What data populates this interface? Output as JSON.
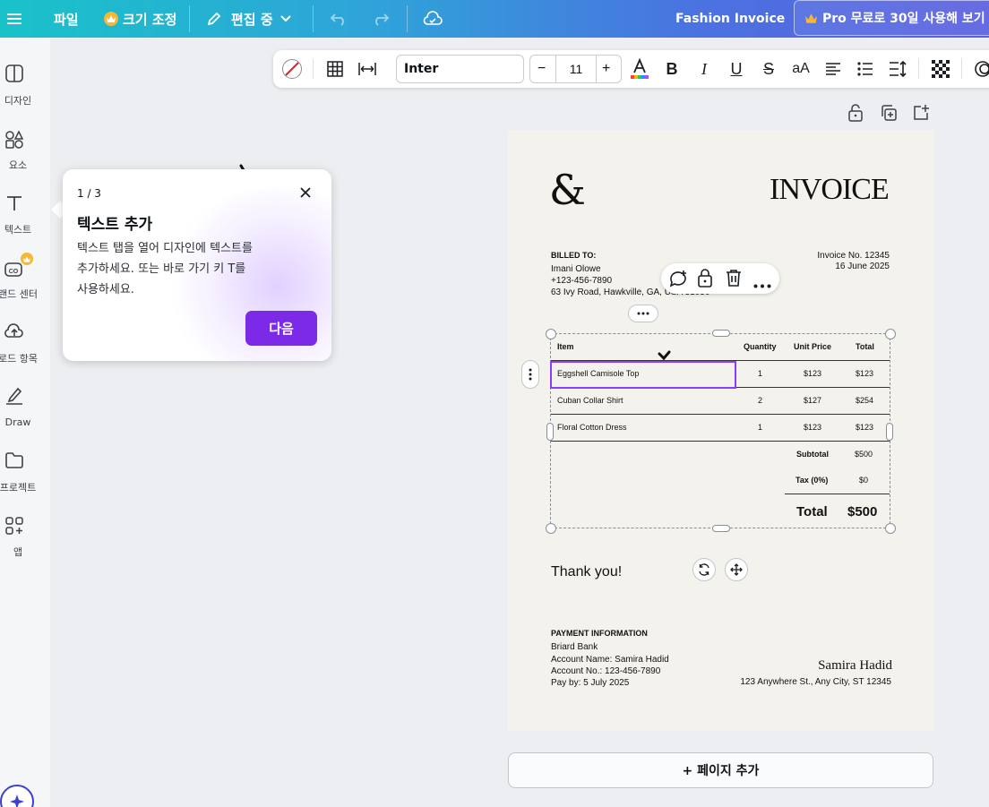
{
  "topbar": {
    "menu_icon": "hamburger-icon",
    "file": "파일",
    "resize": "크기 조정",
    "edit_mode": "편집 중",
    "doc_title": "Fashion Invoice",
    "pro_button": "Pro 무료로 30일 사용해 보기",
    "brand_color": "#7d2ae8"
  },
  "sidebar": {
    "items": [
      {
        "label": "디자인",
        "icon": "layout-icon"
      },
      {
        "label": "요소",
        "icon": "shapes-icon"
      },
      {
        "label": "텍스트",
        "icon": "text-icon"
      },
      {
        "label": "랜드 센터",
        "icon": "brand-icon"
      },
      {
        "label": "로드 항목",
        "icon": "upload-icon"
      },
      {
        "label": "Draw",
        "icon": "draw-icon"
      },
      {
        "label": "프로젝트",
        "icon": "folder-icon"
      },
      {
        "label": "앱",
        "icon": "apps-icon"
      }
    ]
  },
  "toolbar": {
    "font": "Inter",
    "font_size": "11",
    "minus": "−",
    "plus": "+",
    "case": "aA"
  },
  "tooltip": {
    "step": "1 / 3",
    "title": "텍스트 추가",
    "body": [
      "텍스트 탭을 열어 디자인에 텍스트를",
      "추가하세요. 또는 바로 가기 키 T를",
      "사용하세요."
    ],
    "next": "다음"
  },
  "invoice": {
    "logo": "&",
    "heading": "INVOICE",
    "billed_to_label": "BILLED TO:",
    "client_name": "Imani Olowe",
    "client_phone": "+123-456-7890",
    "client_address": "63 Ivy Road, Hawkville, GA, USA 31036",
    "invoice_no": "Invoice No. 12345",
    "date": "16 June 2025",
    "columns": [
      "Item",
      "Quantity",
      "Unit Price",
      "Total"
    ],
    "rows": [
      {
        "item": "Eggshell Camisole Top",
        "qty": "1",
        "price": "$123",
        "total": "$123"
      },
      {
        "item": "Cuban Collar Shirt",
        "qty": "2",
        "price": "$127",
        "total": "$254"
      },
      {
        "item": "Floral Cotton Dress",
        "qty": "1",
        "price": "$123",
        "total": "$123"
      }
    ],
    "subtotal_label": "Subtotal",
    "subtotal": "$500",
    "tax_label": "Tax (0%)",
    "tax": "$0",
    "total_label": "Total",
    "total": "$500",
    "thanks": "Thank you!",
    "payment_label": "PAYMENT INFORMATION",
    "bank": "Briard Bank",
    "account_name": "Account Name: Samira Hadid",
    "account_no": "Account No.: 123-456-7890",
    "pay_by": "Pay by: 5 July 2025",
    "signature": "Samira Hadid",
    "company_address": "123 Anywhere St., Any City, ST 12345"
  },
  "add_page": "+ 페이지 추가"
}
